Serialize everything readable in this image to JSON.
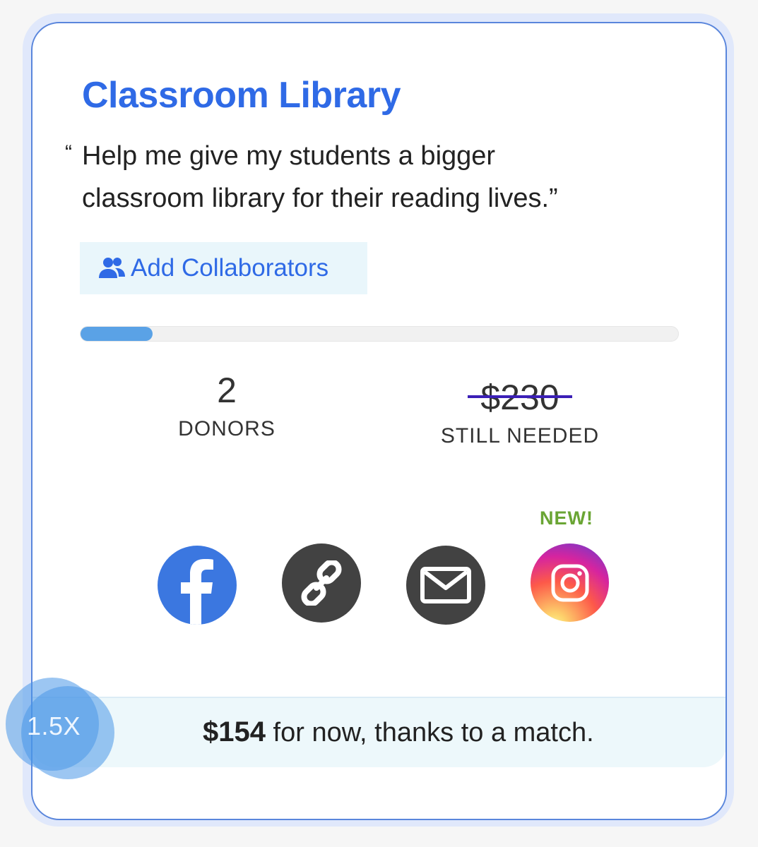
{
  "project": {
    "title": "Classroom Library",
    "quote_open": "“",
    "quote_line1": "Help me give my students a bigger",
    "quote_line2": "classroom library for their reading lives.”"
  },
  "collaborators": {
    "label": "Add Collaborators",
    "icon": "users-icon"
  },
  "progress": {
    "funded_fraction": 0.12
  },
  "stats": {
    "donors_value": "2",
    "donors_label": "DONORS",
    "needed_value": "$230",
    "needed_label": "STILL NEEDED"
  },
  "share": {
    "new_badge": "NEW!",
    "buttons": [
      "facebook-icon",
      "link-icon",
      "email-icon",
      "instagram-icon"
    ]
  },
  "match": {
    "multiplier": "1.5X",
    "amount": "$154",
    "text": " for now, thanks to a match."
  },
  "colors": {
    "accent": "#2f6ae6",
    "progress": "#5aa2e6",
    "facebook": "#3b77e0",
    "icon_dark": "#424242",
    "new_badge": "#6aa534",
    "strike": "#3b1fb6"
  }
}
